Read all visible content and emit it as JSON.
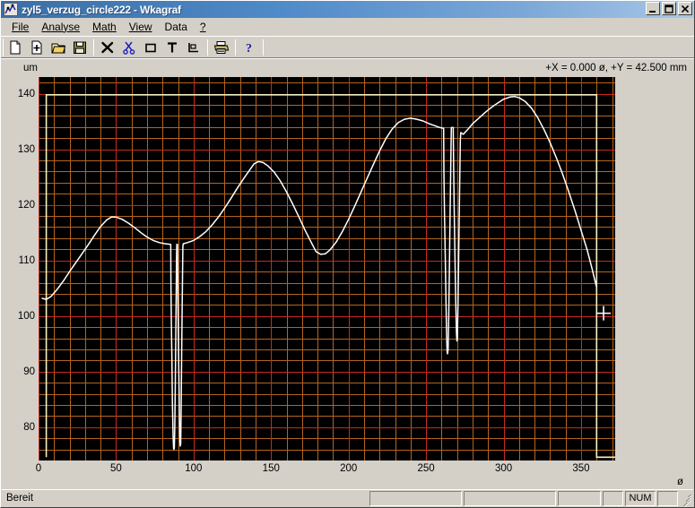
{
  "window": {
    "title": "zyl5_verzug_circle222 - Wkagraf",
    "icon": "app-chart-icon",
    "buttons": [
      {
        "name": "minimize-button",
        "glyph": "_"
      },
      {
        "name": "maximize-button",
        "glyph": "□"
      },
      {
        "name": "close-button",
        "glyph": "✕"
      }
    ]
  },
  "menu": [
    {
      "label": "File",
      "accel": "F"
    },
    {
      "label": "Analyse",
      "accel": "A"
    },
    {
      "label": "Math",
      "accel": "M"
    },
    {
      "label": "View",
      "accel": "V"
    },
    {
      "label": "Data",
      "accel": "D"
    },
    {
      "label": "?",
      "accel": "?"
    }
  ],
  "toolbar": [
    {
      "name": "new-document-icon",
      "tip": "New"
    },
    {
      "name": "add-document-icon",
      "tip": "Add"
    },
    {
      "name": "open-folder-icon",
      "tip": "Open"
    },
    {
      "name": "save-disk-icon",
      "tip": "Save"
    },
    {
      "name": "delete-x-icon",
      "tip": "Delete"
    },
    {
      "name": "scissors-cut-icon",
      "tip": "Cut"
    },
    {
      "name": "rectangle-icon",
      "tip": "Rectangle"
    },
    {
      "name": "text-tool-icon",
      "tip": "Text"
    },
    {
      "name": "axes-icon",
      "tip": "Axes"
    },
    {
      "name": "printer-icon",
      "tip": "Print"
    },
    {
      "name": "help-question-icon",
      "tip": "Help"
    }
  ],
  "statusbar": {
    "message": "Bereit",
    "panels": [
      "",
      "",
      "",
      ""
    ],
    "num_indicator": "NUM"
  },
  "colors": {
    "plot_background": "#000000",
    "grid_minor": "#b4641e",
    "grid_major": "#c8281e",
    "curve": "#ffffff",
    "limit_box": "#f5f0c0",
    "marker": "#ffffff",
    "title_bar": "#3b6ea5"
  },
  "chart_data": {
    "type": "line",
    "title": "",
    "annotation": "+X = 0.000 ø, +Y = 42.500 mm",
    "xlabel": "ø",
    "ylabel": "um",
    "xlim": [
      0,
      372
    ],
    "ylim": [
      74,
      143
    ],
    "xticks": [
      0,
      50,
      100,
      150,
      200,
      250,
      300,
      350
    ],
    "yticks": [
      80,
      90,
      100,
      110,
      120,
      130,
      140
    ],
    "grid": true,
    "grid_minor_step_x": 10,
    "grid_minor_step_y": 2,
    "grid_major_step_x": 50,
    "grid_major_step_y": 10,
    "legend": null,
    "limit_box": {
      "x0": 5,
      "x1": 360,
      "y_top": 139.8,
      "y_bottom": 74.6
    },
    "marker": {
      "x": 364.5,
      "y": 100.5,
      "symbol": "plus"
    },
    "series": [
      {
        "name": "verzug_circle222",
        "points": [
          [
            2,
            103.2
          ],
          [
            5,
            103.0
          ],
          [
            8,
            103.5
          ],
          [
            12,
            104.8
          ],
          [
            16,
            106.3
          ],
          [
            20,
            108.0
          ],
          [
            24,
            109.6
          ],
          [
            28,
            111.2
          ],
          [
            32,
            112.8
          ],
          [
            36,
            114.5
          ],
          [
            40,
            116.1
          ],
          [
            44,
            117.3
          ],
          [
            47,
            117.8
          ],
          [
            50,
            117.8
          ],
          [
            54,
            117.4
          ],
          [
            58,
            116.7
          ],
          [
            62,
            115.9
          ],
          [
            66,
            115.0
          ],
          [
            70,
            114.2
          ],
          [
            74,
            113.6
          ],
          [
            78,
            113.2
          ],
          [
            82,
            113.0
          ],
          [
            85,
            112.9
          ],
          [
            85.3,
            112.9
          ],
          [
            85.4,
            106.0
          ],
          [
            85.6,
            100.0
          ],
          [
            86.0,
            92.0
          ],
          [
            86.4,
            84.0
          ],
          [
            86.8,
            78.5
          ],
          [
            87.1,
            76.2
          ],
          [
            87.3,
            76.0
          ],
          [
            87.6,
            76.3
          ],
          [
            87.9,
            80.0
          ],
          [
            88.2,
            88.0
          ],
          [
            88.5,
            96.0
          ],
          [
            88.8,
            104.0
          ],
          [
            89.0,
            110.0
          ],
          [
            89.2,
            112.9
          ],
          [
            89.6,
            112.9
          ],
          [
            89.8,
            106.0
          ],
          [
            90.1,
            98.0
          ],
          [
            90.5,
            90.0
          ],
          [
            90.9,
            82.0
          ],
          [
            91.2,
            77.5
          ],
          [
            91.4,
            76.6
          ],
          [
            91.7,
            77.0
          ],
          [
            92.0,
            83.0
          ],
          [
            92.3,
            92.0
          ],
          [
            92.6,
            101.0
          ],
          [
            92.9,
            108.0
          ],
          [
            93.1,
            112.4
          ],
          [
            93.3,
            113.0
          ],
          [
            96,
            113.2
          ],
          [
            100,
            113.6
          ],
          [
            104,
            114.3
          ],
          [
            108,
            115.2
          ],
          [
            112,
            116.4
          ],
          [
            116,
            117.8
          ],
          [
            120,
            119.4
          ],
          [
            124,
            121.1
          ],
          [
            128,
            122.9
          ],
          [
            132,
            124.6
          ],
          [
            136,
            126.2
          ],
          [
            139,
            127.4
          ],
          [
            142,
            127.8
          ],
          [
            145,
            127.6
          ],
          [
            148,
            127.0
          ],
          [
            152,
            125.9
          ],
          [
            156,
            124.3
          ],
          [
            160,
            122.3
          ],
          [
            164,
            120.1
          ],
          [
            168,
            117.8
          ],
          [
            172,
            115.4
          ],
          [
            176,
            113.2
          ],
          [
            179,
            111.6
          ],
          [
            182,
            111.1
          ],
          [
            185,
            111.2
          ],
          [
            188,
            111.9
          ],
          [
            192,
            113.3
          ],
          [
            196,
            115.2
          ],
          [
            200,
            117.4
          ],
          [
            204,
            119.8
          ],
          [
            208,
            122.3
          ],
          [
            212,
            124.8
          ],
          [
            216,
            127.3
          ],
          [
            220,
            129.7
          ],
          [
            224,
            131.9
          ],
          [
            228,
            133.6
          ],
          [
            232,
            134.8
          ],
          [
            236,
            135.4
          ],
          [
            240,
            135.6
          ],
          [
            244,
            135.4
          ],
          [
            248,
            135.1
          ],
          [
            252,
            134.6
          ],
          [
            256,
            134.2
          ],
          [
            259,
            133.9
          ],
          [
            261,
            133.8
          ],
          [
            261.3,
            133.8
          ],
          [
            261.5,
            126.0
          ],
          [
            261.9,
            118.0
          ],
          [
            262.4,
            110.0
          ],
          [
            262.9,
            102.0
          ],
          [
            263.3,
            96.0
          ],
          [
            263.6,
            93.5
          ],
          [
            263.9,
            93.2
          ],
          [
            264.2,
            94.0
          ],
          [
            264.6,
            100.0
          ],
          [
            265.0,
            108.0
          ],
          [
            265.4,
            116.0
          ],
          [
            265.8,
            124.0
          ],
          [
            266.1,
            131.0
          ],
          [
            266.3,
            133.9
          ],
          [
            267.5,
            133.9
          ],
          [
            267.8,
            126.0
          ],
          [
            268.2,
            118.0
          ],
          [
            268.7,
            110.0
          ],
          [
            269.2,
            102.0
          ],
          [
            269.6,
            97.0
          ],
          [
            269.9,
            95.5
          ],
          [
            270.2,
            96.0
          ],
          [
            270.6,
            102.0
          ],
          [
            271.0,
            110.0
          ],
          [
            271.4,
            118.0
          ],
          [
            271.8,
            126.0
          ],
          [
            272.1,
            131.5
          ],
          [
            272.4,
            133.0
          ],
          [
            274,
            132.7
          ],
          [
            277,
            133.6
          ],
          [
            280,
            134.6
          ],
          [
            284,
            135.6
          ],
          [
            288,
            136.6
          ],
          [
            292,
            137.5
          ],
          [
            296,
            138.3
          ],
          [
            300,
            139.0
          ],
          [
            304,
            139.4
          ],
          [
            307,
            139.5
          ],
          [
            310,
            139.3
          ],
          [
            314,
            138.6
          ],
          [
            318,
            137.4
          ],
          [
            322,
            135.7
          ],
          [
            326,
            133.6
          ],
          [
            330,
            131.2
          ],
          [
            334,
            128.5
          ],
          [
            338,
            125.6
          ],
          [
            342,
            122.4
          ],
          [
            346,
            119.0
          ],
          [
            350,
            115.4
          ],
          [
            354,
            111.8
          ],
          [
            357,
            108.6
          ],
          [
            359,
            106.3
          ],
          [
            360,
            105.2
          ]
        ]
      }
    ]
  }
}
